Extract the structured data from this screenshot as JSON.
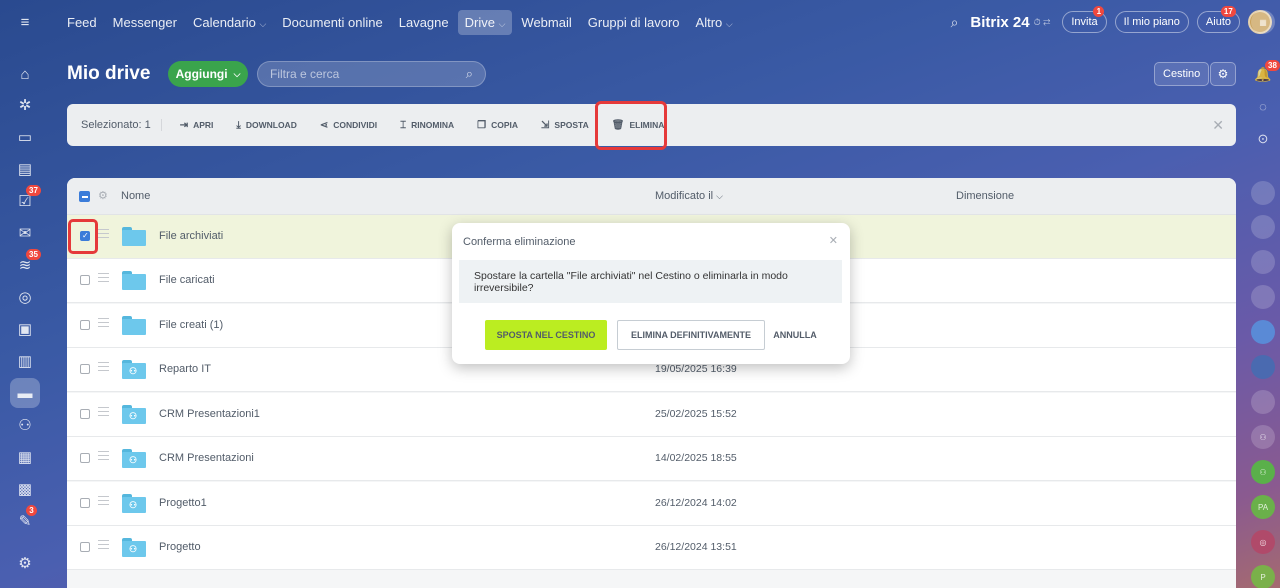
{
  "top_nav": {
    "items": [
      "Feed",
      "Messenger",
      "Calendario",
      "Documenti online",
      "Lavagne",
      "Drive",
      "Webmail",
      "Gruppi di lavoro",
      "Altro"
    ],
    "active": "Drive"
  },
  "top_right": {
    "brand": "Bitrix 24",
    "invite_label": "Invita",
    "invite_badge": "1",
    "plan_label": "Il mio piano",
    "help_label": "Aiuto",
    "help_badge": "17"
  },
  "left_bar": {
    "badges": {
      "tasks": "37",
      "feed": "35",
      "todo": "3"
    }
  },
  "right_bar": {
    "notification_badge": "38",
    "avatar_initials": [
      "PA",
      "P"
    ]
  },
  "page": {
    "title": "Mio drive",
    "add_label": "Aggiungi",
    "search_placeholder": "Filtra e cerca",
    "trash_label": "Cestino"
  },
  "toolbar": {
    "selected_text": "Selezionato: 1",
    "actions": [
      "APRI",
      "DOWNLOAD",
      "CONDIVIDI",
      "RINOMINA",
      "COPIA",
      "SPOSTA",
      "ELIMINA"
    ]
  },
  "grid": {
    "col_name": "Nome",
    "col_modified": "Modificato il",
    "col_size": "Dimensione",
    "rows": [
      {
        "name": "File archiviati",
        "date": "",
        "shared": false,
        "selected": true
      },
      {
        "name": "File caricati",
        "date": "",
        "shared": false,
        "selected": false
      },
      {
        "name": "File creati (1)",
        "date": "",
        "shared": false,
        "selected": false
      },
      {
        "name": "Reparto IT",
        "date": "19/05/2025 16:39",
        "shared": true,
        "selected": false
      },
      {
        "name": "CRM Presentazioni1",
        "date": "25/02/2025 15:52",
        "shared": true,
        "selected": false
      },
      {
        "name": "CRM Presentazioni",
        "date": "14/02/2025 18:55",
        "shared": true,
        "selected": false
      },
      {
        "name": "Progetto1",
        "date": "26/12/2024 14:02",
        "shared": true,
        "selected": false
      },
      {
        "name": "Progetto",
        "date": "26/12/2024 13:51",
        "shared": true,
        "selected": false
      }
    ]
  },
  "dialog": {
    "title": "Conferma eliminazione",
    "message": "Spostare la cartella \"File archiviati\" nel Cestino o eliminarla in modo irreversibile?",
    "move_label": "SPOSTA NEL CESTINO",
    "delete_label": "ELIMINA DEFINITIVAMENTE",
    "cancel_label": "ANNULLA"
  },
  "colors": {
    "accent_green": "#bbed21",
    "add_button": "#3aa44c",
    "highlight_red": "#e5393a",
    "checkbox_blue": "#3b7cd9"
  }
}
